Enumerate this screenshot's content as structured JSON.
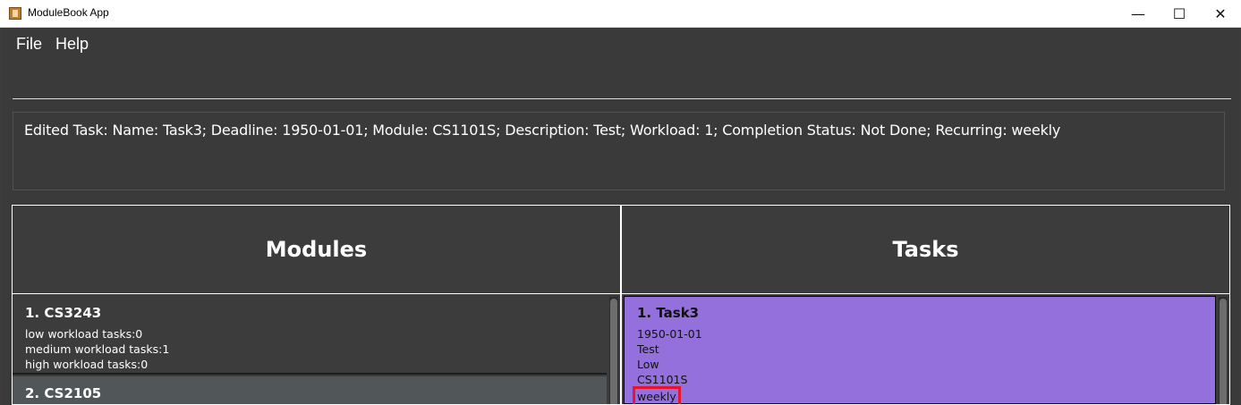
{
  "window": {
    "title": "ModuleBook App",
    "minimize_glyph": "—",
    "maximize_glyph": "☐",
    "close_glyph": "✕"
  },
  "menu": {
    "items": [
      "File",
      "Help"
    ]
  },
  "command": {
    "value": ""
  },
  "result": {
    "text": "Edited Task: Name: Task3; Deadline: 1950-01-01; Module: CS1101S; Description: Test; Workload: 1; Completion Status: Not Done; Recurring: weekly"
  },
  "modules": {
    "heading": "Modules",
    "items": [
      {
        "title": "1.  CS3243",
        "lines": [
          "low workload tasks:0",
          "medium workload tasks:1",
          "high workload tasks:0"
        ]
      },
      {
        "title": "2.  CS2105",
        "lines": []
      }
    ]
  },
  "tasks": {
    "heading": "Tasks",
    "items": [
      {
        "title": "1.  Task3",
        "deadline": "1950-01-01",
        "description": "Test",
        "workload": "Low",
        "module": "CS1101S",
        "recurring": "weekly"
      }
    ]
  },
  "colors": {
    "background": "#3c3c3c",
    "task_card": "#9370db",
    "highlight_border": "#e8132c"
  }
}
